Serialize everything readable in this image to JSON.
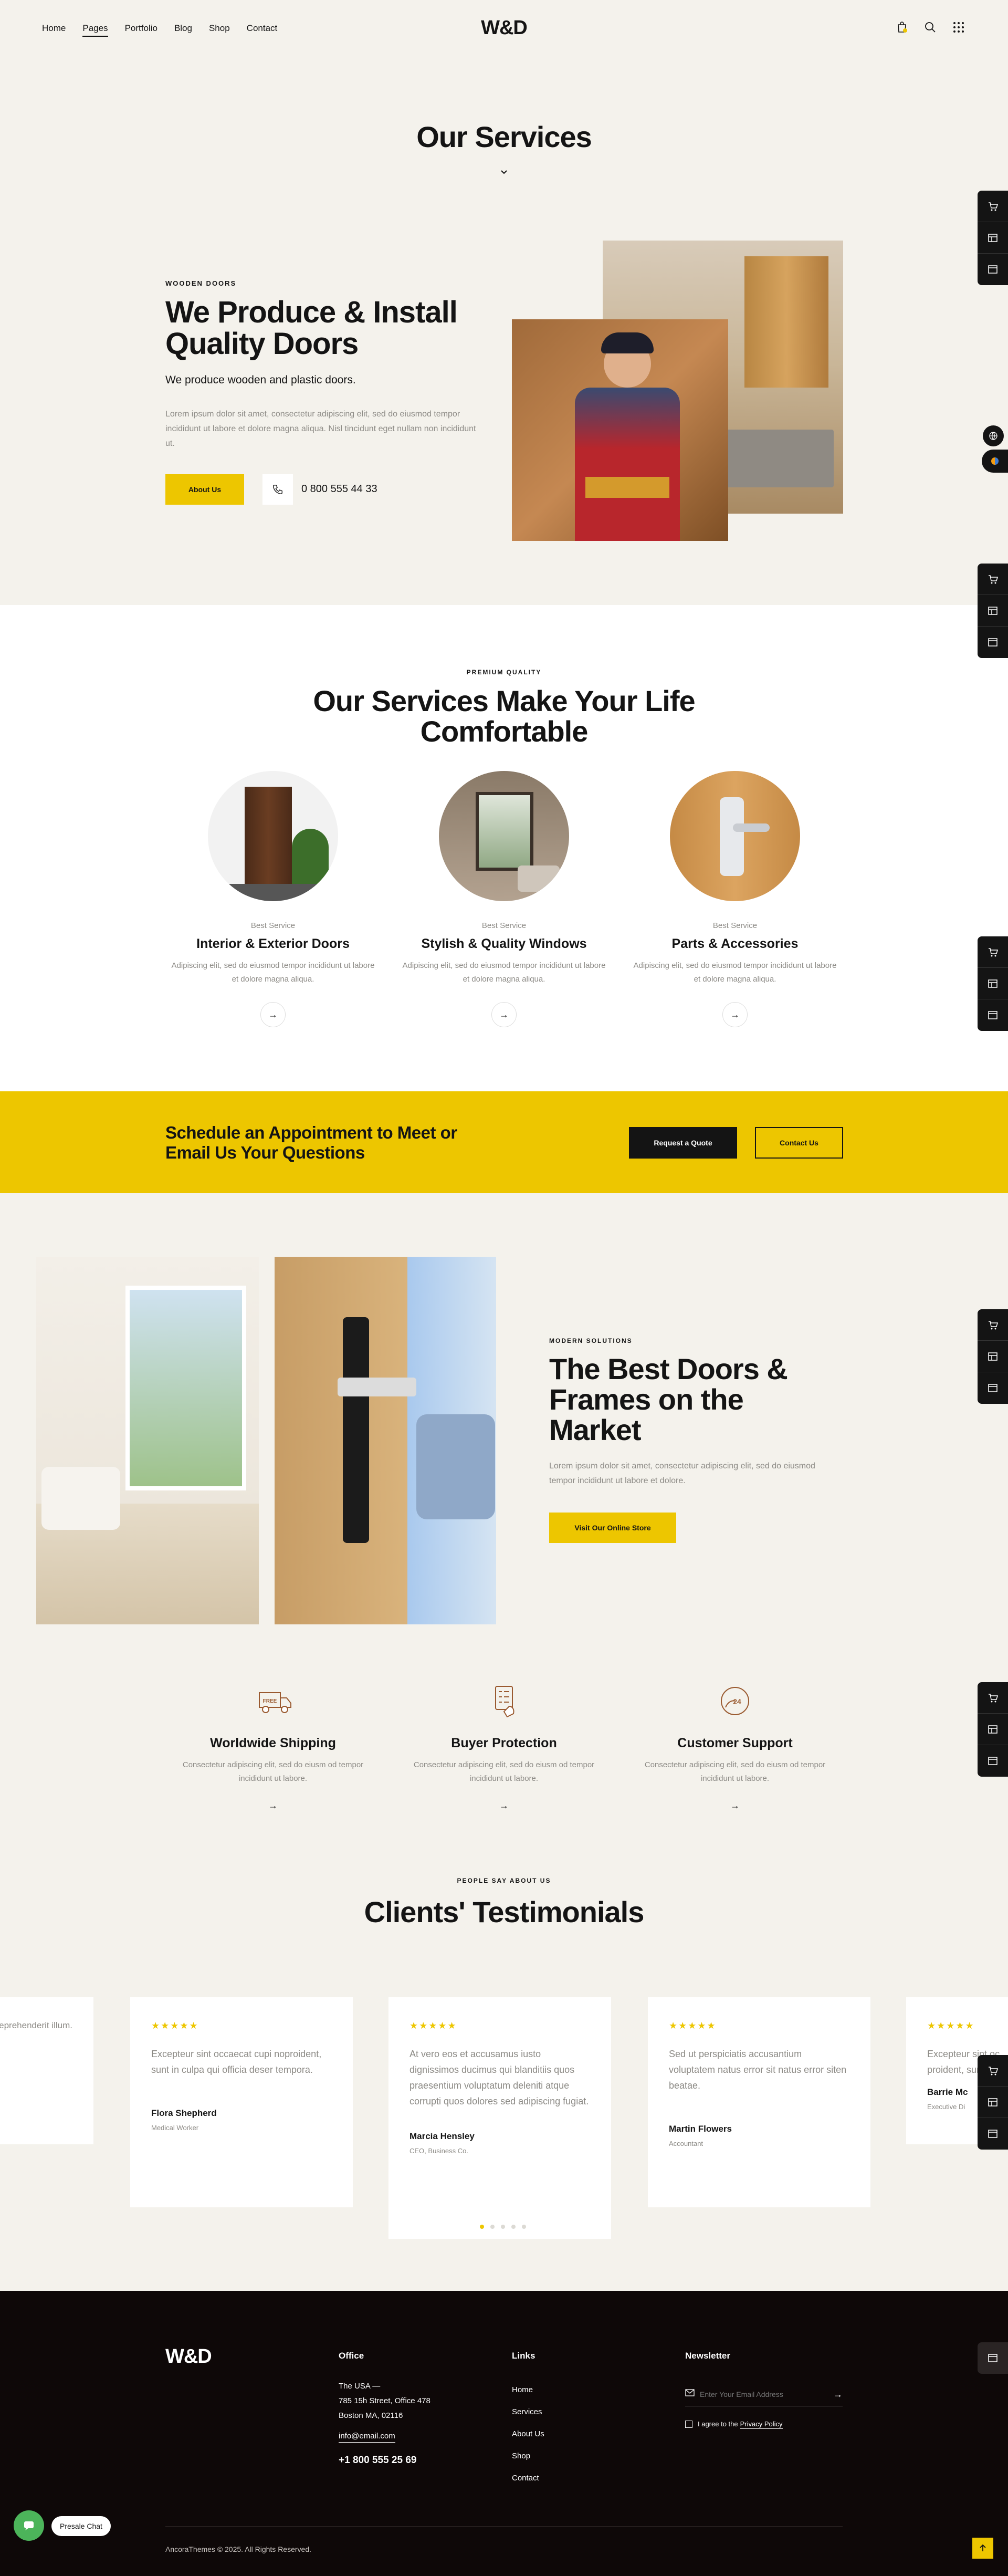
{
  "header": {
    "nav": [
      "Home",
      "Pages",
      "Portfolio",
      "Blog",
      "Shop",
      "Contact"
    ],
    "logo": "W&D"
  },
  "hero": {
    "title": "Our Services"
  },
  "doors": {
    "eyebrow": "WOODEN DOORS",
    "title_line1": "We Produce & Install",
    "title_line2": "Quality Doors",
    "subtitle": "We produce wooden and plastic doors.",
    "body": "Lorem ipsum dolor sit amet, consectetur adipiscing elit, sed do eiusmod tempor incididunt ut labore et dolore magna aliqua. Nisl tincidunt eget nullam non incididunt ut.",
    "button": "About Us",
    "phone": "0 800 555 44 33"
  },
  "services": {
    "eyebrow": "PREMIUM QUALITY",
    "title_line1": "Our Services Make Your Life",
    "title_line2": "Comfortable",
    "cards": [
      {
        "kicker": "Best Service",
        "title": "Interior & Exterior Doors",
        "text": "Adipiscing elit, sed do eiusmod tempor incididunt ut labore et dolore magna aliqua."
      },
      {
        "kicker": "Best Service",
        "title": "Stylish & Quality Windows",
        "text": "Adipiscing elit, sed do eiusmod tempor incididunt ut labore et dolore magna aliqua."
      },
      {
        "kicker": "Best Service",
        "title": "Parts & Accessories",
        "text": "Adipiscing elit, sed do eiusmod tempor incididunt ut labore et dolore magna aliqua."
      }
    ]
  },
  "cta": {
    "title_line1": "Schedule an Appointment to Meet or",
    "title_line2": "Email Us Your Questions",
    "quote_button": "Request a Quote",
    "contact_button": "Contact Us"
  },
  "market": {
    "eyebrow": "MODERN SOLUTIONS",
    "title_line1": "The Best Doors &",
    "title_line2": "Frames on the",
    "title_line3": "Market",
    "body": "Lorem ipsum dolor sit amet, consectetur adipiscing elit, sed do eiusmod tempor incididunt ut labore et dolore.",
    "button": "Visit Our Online Store"
  },
  "features": [
    {
      "title": "Worldwide Shipping",
      "text": "Consectetur adipiscing elit, sed do eiusm od tempor incididunt ut labore.",
      "icon_badge": "FREE"
    },
    {
      "title": "Buyer Protection",
      "text": "Consectetur adipiscing elit, sed do eiusm od tempor incididunt ut labore."
    },
    {
      "title": "Customer Support",
      "text": "Consectetur adipiscing elit, sed do eiusm od tempor incididunt ut labore.",
      "icon_badge": "24"
    }
  ],
  "testimonials": {
    "eyebrow": "PEOPLE SAY ABOUT US",
    "title": "Clients' Testimonials",
    "stars": "★★★★★",
    "partial_left_text": "eprehenderit illum.",
    "cards": [
      {
        "quote": "Excepteur sint occaecat cupi noproident, sunt in culpa qui officia deser tempora.",
        "name": "Flora Shepherd",
        "role": "Medical Worker"
      },
      {
        "quote": "At vero eos et accusamus iusto dignissimos ducimus qui blanditiis quos praesentium voluptatum deleniti atque corrupti quos dolores sed adipiscing fugiat.",
        "name": "Marcia Hensley",
        "role": "CEO, Business Co."
      },
      {
        "quote": "Sed ut perspiciatis accusantium voluptatem natus error sit natus error siten beatae.",
        "name": "Martin Flowers",
        "role": "Accountant"
      },
      {
        "quote": "Excepteur sint oc proident, sunt in",
        "name": "Barrie Mc",
        "role": "Executive Di"
      }
    ]
  },
  "footer": {
    "logo": "W&D",
    "office_title": "Office",
    "address_l1": "The USA —",
    "address_l2": "785 15h Street, Office 478",
    "address_l3": "Boston MA, 02116",
    "email": "info@email.com",
    "phone": "+1 800 555 25 69",
    "links_title": "Links",
    "links": [
      "Home",
      "Services",
      "About Us",
      "Shop",
      "Contact"
    ],
    "newsletter_title": "Newsletter",
    "email_placeholder": "Enter Your Email Address",
    "agree_prefix": "I agree to the",
    "agree_link": "Privacy Policy",
    "copyright": "AncoraThemes © 2025. All Rights Reserved.",
    "chat_label": "Presale Chat"
  },
  "colors": {
    "accent": "#edc600",
    "dark": "#0e0808",
    "bg": "#f4f2ec"
  }
}
